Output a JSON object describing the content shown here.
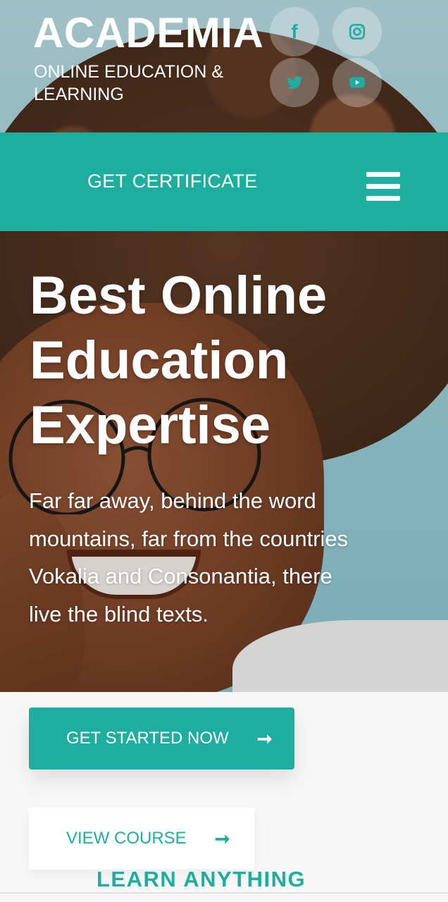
{
  "header": {
    "brand_title": "ACADEMIA",
    "brand_subtitle": "ONLINE EDUCATION & LEARNING",
    "social": [
      {
        "name": "facebook-icon",
        "glyph": "f"
      },
      {
        "name": "instagram-icon"
      },
      {
        "name": "twitter-icon"
      },
      {
        "name": "youtube-icon"
      }
    ]
  },
  "nav": {
    "link_label": "GET CERTIFICATE",
    "menu_icon": "hamburger-menu-icon"
  },
  "hero": {
    "heading": "Best Online Education Expertise",
    "text": "Far far away, behind the word mountains, far from the countries Vokalia and Consonantia, there live the blind texts."
  },
  "cta": {
    "primary_label": "GET STARTED NOW",
    "secondary_label": "VIEW COURSE",
    "arrow": "➞"
  },
  "section": {
    "title": "LEARN ANYTHING"
  },
  "colors": {
    "accent": "#1eaea0",
    "background": "#f7f7f7",
    "white": "#ffffff"
  }
}
